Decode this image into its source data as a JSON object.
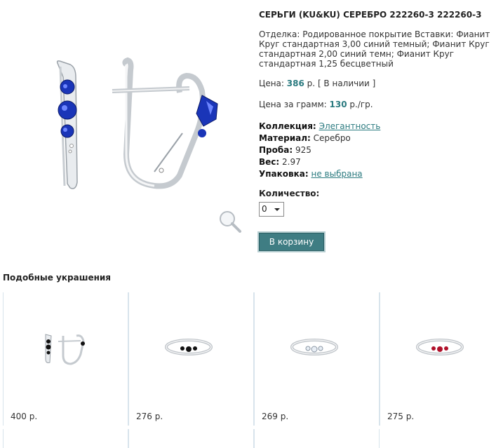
{
  "product": {
    "title": "СЕРЬГИ (KU&KU) СЕРЕБРО 222260-3 222260-3",
    "description": "Отделка: Родированное покрытие Вставки: Фианит Круг стандартная 3,00 синий темный; Фианит Круг стандартная 2,00 синий темн; Фианит Круг стандартная 1,25 бесцветный",
    "price_label": "Цена:",
    "price_value": "386",
    "price_unit": "р.",
    "availability": "[ В наличии ]",
    "price_per_gram_label": "Цена за грамм:",
    "price_per_gram_value": "130",
    "price_per_gram_unit": "р./гр.",
    "collection_label": "Коллекция:",
    "collection_value": "Элегантность",
    "material_label": "Материал:",
    "material_value": "Серебро",
    "probe_label": "Проба:",
    "probe_value": "925",
    "weight_label": "Вес:",
    "weight_value": "2.97",
    "packaging_label": "Упаковка:",
    "packaging_value": "не выбрана",
    "quantity_label": "Количество:",
    "quantity_value": "0",
    "cart_button": "В корзину"
  },
  "similar": {
    "title": "Подобные украшения",
    "items": [
      {
        "price": "400 р.",
        "kind": "earrings-black"
      },
      {
        "price": "276 р.",
        "kind": "ring-black"
      },
      {
        "price": "269 р.",
        "kind": "ring-white"
      },
      {
        "price": "275 р.",
        "kind": "ring-red"
      }
    ]
  },
  "colors": {
    "accent": "#2c7b80",
    "button_bg": "#3f7d83",
    "sapphire": "#1a35b8",
    "ruby": "#b0102a",
    "onyx": "#111111"
  }
}
